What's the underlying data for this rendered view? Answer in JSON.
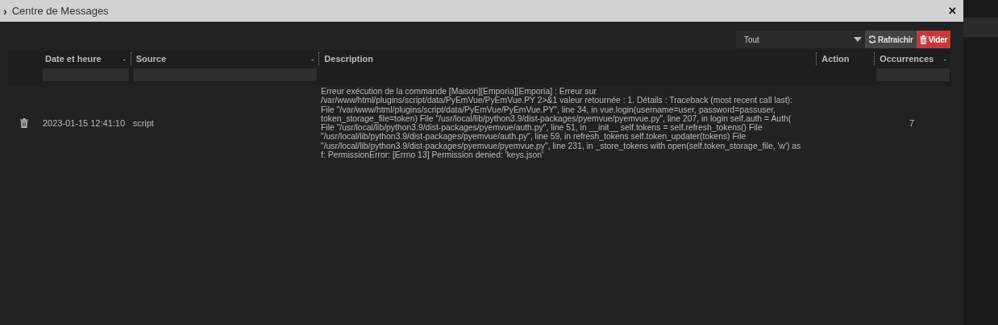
{
  "window": {
    "title": "Centre de Messages",
    "expand_glyph": "›",
    "close_glyph": "✕"
  },
  "toolbar": {
    "filter_select": {
      "value": "Tout"
    },
    "buttons": [
      {
        "kind": "refresh",
        "label": "Rafraichir"
      },
      {
        "kind": "clear",
        "label": "Vider"
      }
    ]
  },
  "table": {
    "columns": [
      {
        "label": "Date et heure",
        "sort_mark": "-",
        "filterable": true
      },
      {
        "label": "Source",
        "sort_mark": "-",
        "filterable": true
      },
      {
        "label": "Description",
        "filterable": false
      },
      {
        "label": "Action",
        "filterable": false
      },
      {
        "label": "Occurrences",
        "sort_mark": "-",
        "filterable": true
      }
    ],
    "rows": [
      {
        "date": "2023-01-15 12:41:10",
        "source": "script",
        "description": "Erreur exécution de la commande [Maison][Emporia][Emporia] : Erreur sur /var/www/html/plugins/script/data/PyEmVue/PyEmVue.PY 2>&1 valeur retournée : 1. Détails : Traceback (most recent call last): File \"/var/www/html/plugins/script/data/PyEmVue/PyEmVue.PY\", line 34, in vue.login(username=user, password=passuser, token_storage_file=token) File \"/usr/local/lib/python3.9/dist-packages/pyemvue/pyemvue.py\", line 207, in login self.auth = Auth( File \"/usr/local/lib/python3.9/dist-packages/pyemvue/auth.py\", line 51, in __init__ self.tokens = self.refresh_tokens() File \"/usr/local/lib/python3.9/dist-packages/pyemvue/auth.py\", line 59, in refresh_tokens self.token_updater(tokens) File \"/usr/local/lib/python3.9/dist-packages/pyemvue/pyemvue.py\", line 231, in _store_tokens with open(self.token_storage_file, 'w') as f: PermissionError: [Errno 13] Permission denied: 'keys.json'",
        "occurrences": "7"
      }
    ]
  }
}
